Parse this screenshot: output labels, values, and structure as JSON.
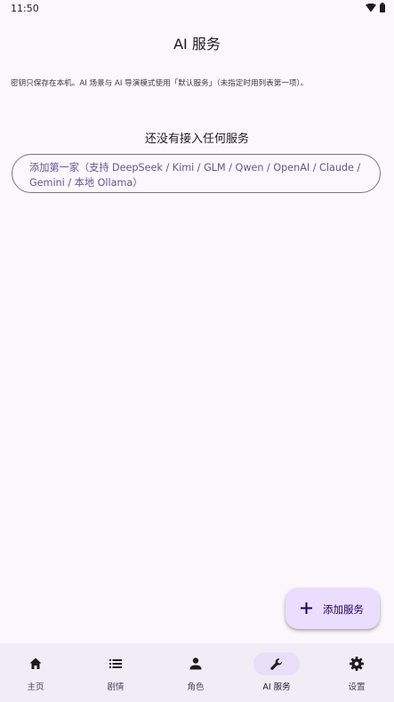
{
  "status": {
    "time": "11:50"
  },
  "app_bar": {
    "title": "AI 服务"
  },
  "note": "密钥只保存在本机。AI 场景与 AI 导演模式使用「默认服务」（未指定时用列表第一项）。",
  "empty_state": {
    "title": "还没有接入任何服务",
    "add_first_line1": "添加第一家（支持 DeepSeek / Kimi / GLM / Qwen / OpenAI / Claude /",
    "add_first_line2": "Gemini / 本地 Ollama）"
  },
  "fab": {
    "label": "添加服务",
    "icon": "plus-icon"
  },
  "bottom_nav": {
    "items": [
      {
        "label": "主页",
        "icon": "home-icon"
      },
      {
        "label": "剧情",
        "icon": "list-icon"
      },
      {
        "label": "角色",
        "icon": "person-icon"
      },
      {
        "label": "AI 服务",
        "icon": "wrench-icon",
        "active": true
      },
      {
        "label": "设置",
        "icon": "gear-icon"
      }
    ]
  },
  "colors": {
    "background": "#fbf7fd",
    "nav_background": "#f2ecf7",
    "accent": "#65558f",
    "fab_background": "#eaddff",
    "active_indicator": "#e8def8"
  }
}
